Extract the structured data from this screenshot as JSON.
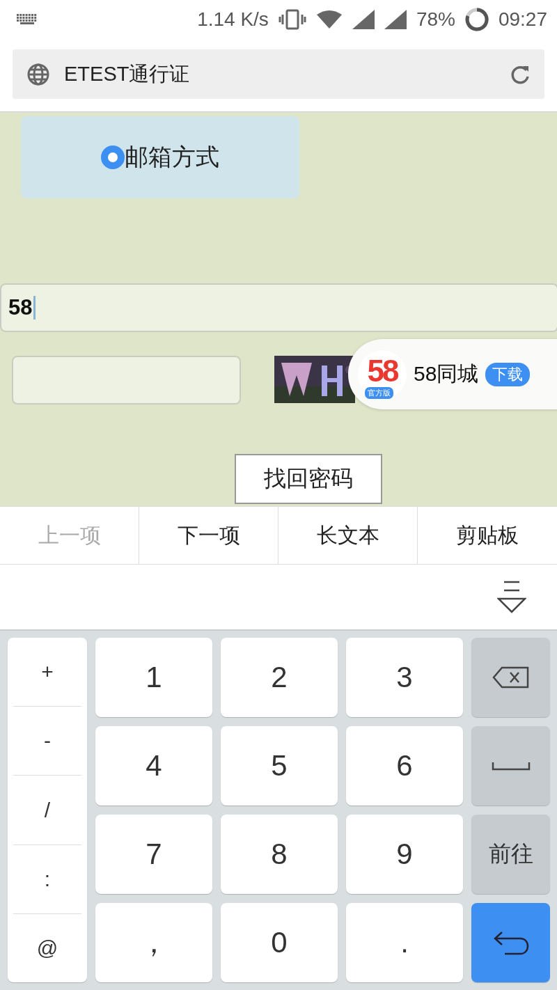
{
  "status_bar": {
    "speed": "1.14 K/s",
    "battery": "78%",
    "time": "09:27"
  },
  "address_bar": {
    "title": "ETEST通行证"
  },
  "page": {
    "radio": {
      "label": "邮箱方式",
      "selected": true
    },
    "account_field": {
      "value": "58"
    },
    "find_button": "找回密码"
  },
  "popup": {
    "logo": "58",
    "badge": "官方版",
    "app": "58同城",
    "action": "下载"
  },
  "toolbar": [
    {
      "label": "上一项",
      "disabled": true
    },
    {
      "label": "下一项",
      "disabled": false
    },
    {
      "label": "长文本",
      "disabled": false
    },
    {
      "label": "剪贴板",
      "disabled": false
    }
  ],
  "keyboard": {
    "side_keys": [
      "+",
      "-",
      "/",
      ":",
      "@"
    ],
    "keys": [
      {
        "label": "1"
      },
      {
        "label": "2"
      },
      {
        "label": "3"
      },
      {
        "label": "4"
      },
      {
        "label": "5"
      },
      {
        "label": "6"
      },
      {
        "label": "7"
      },
      {
        "label": "8"
      },
      {
        "label": "9"
      },
      {
        "label": "，"
      },
      {
        "label": "0"
      },
      {
        "label": "."
      }
    ],
    "right_keys": [
      {
        "kind": "backspace"
      },
      {
        "kind": "space"
      },
      {
        "kind": "text",
        "label": "前往"
      },
      {
        "kind": "enter"
      }
    ]
  }
}
